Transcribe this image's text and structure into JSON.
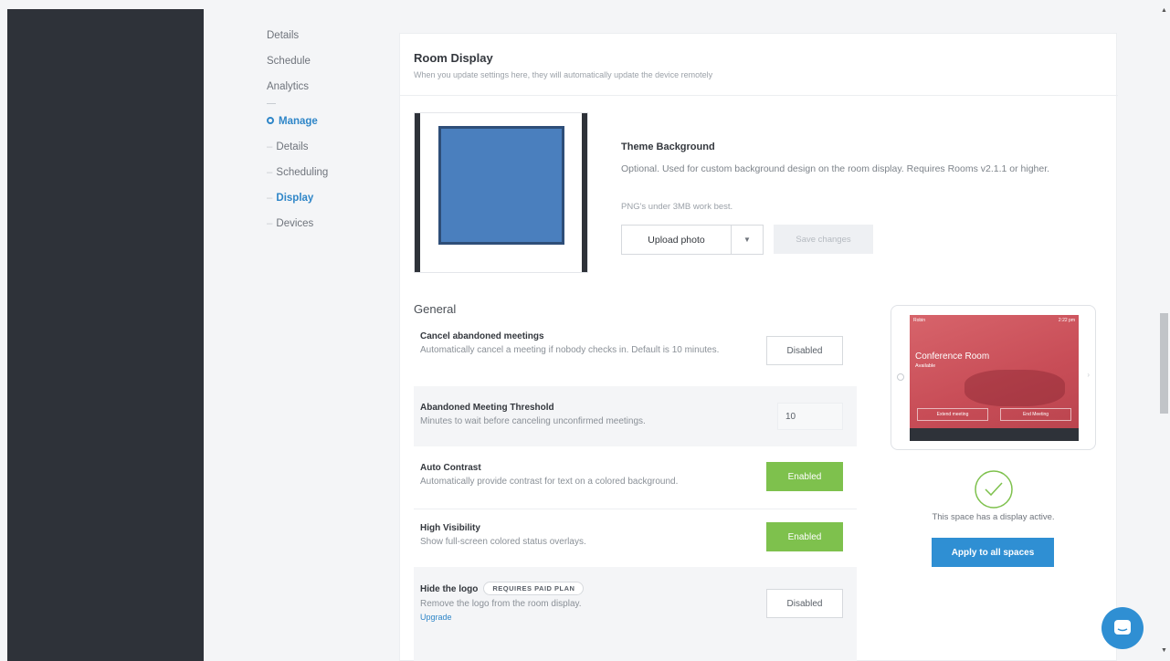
{
  "subnav": {
    "items": [
      {
        "label": "Details"
      },
      {
        "label": "Schedule"
      },
      {
        "label": "Analytics"
      }
    ],
    "manage": {
      "label": "Manage",
      "children": [
        {
          "label": "Details"
        },
        {
          "label": "Scheduling"
        },
        {
          "label": "Display"
        },
        {
          "label": "Devices"
        }
      ]
    }
  },
  "panel": {
    "title": "Room Display",
    "subtitle": "When you update settings here, they will automatically update the device remotely"
  },
  "theme": {
    "title": "Theme Background",
    "description": "Optional. Used for custom background design on the room display. Requires Rooms v2.1.1 or higher.",
    "note": "PNG's under 3MB work best.",
    "upload_label": "Upload photo",
    "save_label": "Save changes"
  },
  "general": {
    "title": "General",
    "settings": [
      {
        "name": "Cancel abandoned meetings",
        "desc": "Automatically cancel a meeting if nobody checks in. Default is 10 minutes.",
        "state": "Disabled"
      },
      {
        "name": "Abandoned Meeting Threshold",
        "desc": "Minutes to wait before canceling unconfirmed meetings.",
        "value": "10"
      },
      {
        "name": "Auto Contrast",
        "desc": "Automatically provide contrast for text on a colored background.",
        "state": "Enabled"
      },
      {
        "name": "High Visibility",
        "desc": "Show full-screen colored status overlays.",
        "state": "Enabled"
      },
      {
        "name": "Hide the logo",
        "badge": "REQUIRES PAID PLAN",
        "desc": "Remove the logo from the room display.",
        "link": "Upgrade",
        "state": "Disabled"
      }
    ]
  },
  "preview": {
    "brand": "Robin",
    "time": "2:22 pm",
    "room_name": "Conference Room",
    "room_status": "Available",
    "btn1": "Extend meeting",
    "btn2": "End Meeting",
    "status_text": "This space has a display active.",
    "apply_label": "Apply to all spaces"
  },
  "colors": {
    "accent": "#2f86c8",
    "enabled": "#7ec14d",
    "sidebar": "#2e3239",
    "apply": "#2f8fd3"
  }
}
